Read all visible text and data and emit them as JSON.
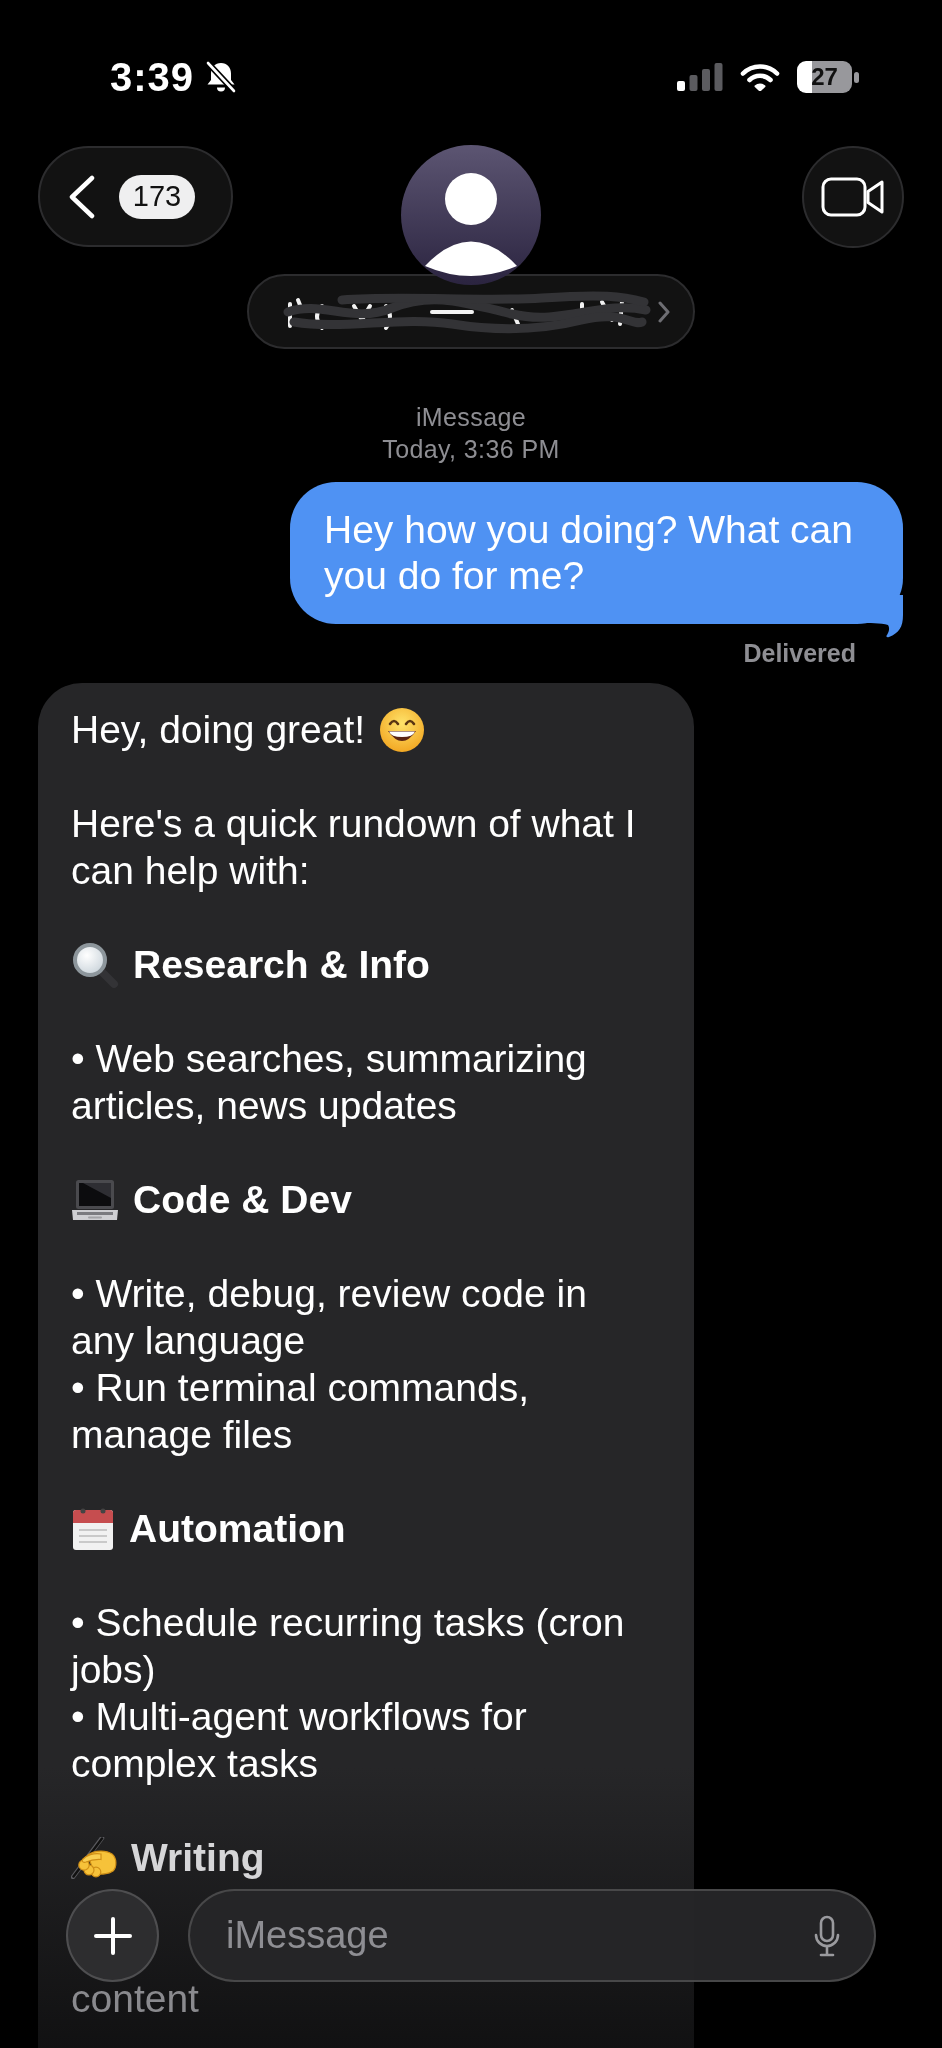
{
  "status_bar": {
    "time": "3:39",
    "silent": true,
    "battery": "27"
  },
  "header": {
    "unread_count": "173"
  },
  "thread": {
    "service": "iMessage",
    "timestamp": "Today, 3:36 PM"
  },
  "messages": [
    {
      "kind": "sent",
      "text": "Hey how you doing? What can\nyou do for me?",
      "status": "Delivered"
    },
    {
      "kind": "received",
      "blocks": [
        {
          "kind": "paragraph",
          "text": "Hey, doing great!"
        },
        {
          "kind": "paragraph",
          "text": "Here's a quick rundown of what I\ncan help with:"
        },
        {
          "kind": "section",
          "heading": "Research & Info",
          "items": [
            "• Web searches, summarizing\narticles, news updates"
          ]
        },
        {
          "kind": "section",
          "heading": "Code & Dev",
          "items": [
            "• Write, debug, review code in\nany language",
            "• Run terminal commands,\nmanage files"
          ]
        },
        {
          "kind": "section",
          "heading": "Automation",
          "items": [
            "• Schedule recurring tasks (cron\njobs)",
            "• Multi-agent workflows for\ncomplex tasks"
          ]
        },
        {
          "kind": "section",
          "heading": "Writing",
          "items": [
            "content"
          ]
        }
      ]
    }
  ],
  "composer": {
    "placeholder": "iMessage"
  }
}
